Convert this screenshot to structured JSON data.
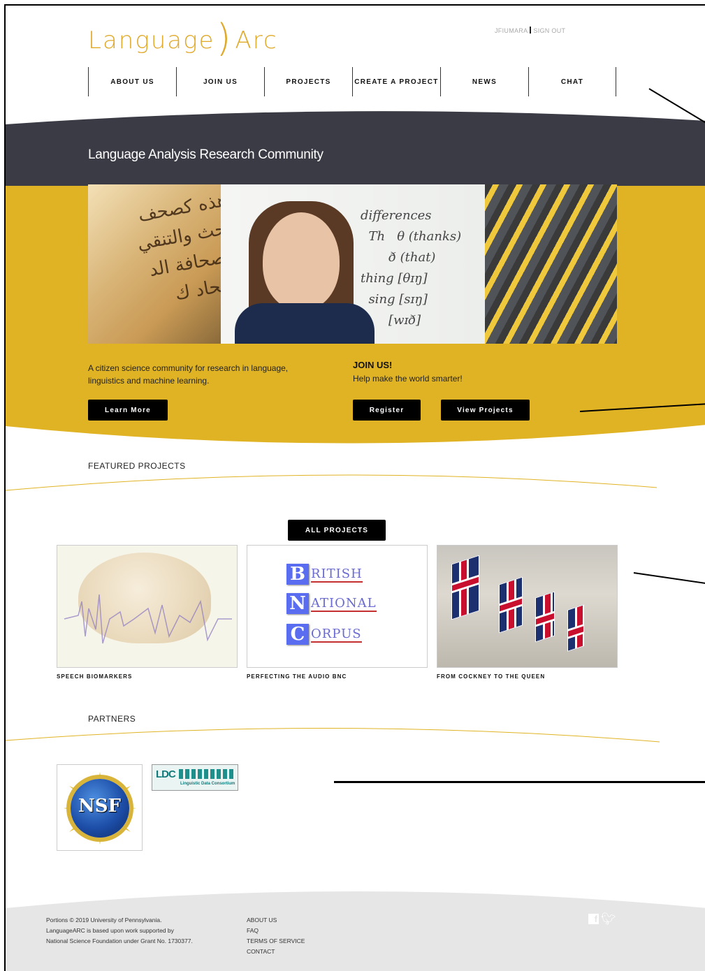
{
  "header": {
    "logo_left": "Language",
    "logo_right": "Arc",
    "user": "JFIUMARA",
    "signout": "SIGN OUT"
  },
  "nav": [
    "ABOUT US",
    "JOIN US",
    "PROJECTS",
    "CREATE A PROJECT",
    "NEWS",
    "CHAT"
  ],
  "hero": {
    "title": "Language Analysis Research Community",
    "description": "A citizen science community for research in language, linguistics and machine learning.",
    "learn_more": "Learn More",
    "join_title": "JOIN US!",
    "join_subtitle": "Help make the world smarter!",
    "register": "Register",
    "view_projects": "View Projects",
    "board_text": "differences\n  Th   θ (thanks)\n       ð (that)\nthing [θɪŋ]\n  sing [sɪŋ]\n       [wɪð]"
  },
  "featured": {
    "label": "FEATURED PROJECTS",
    "all_projects": "ALL PROJECTS",
    "projects": [
      {
        "title": "SPEECH BIOMARKERS"
      },
      {
        "title": "PERFECTING THE AUDIO BNC"
      },
      {
        "title": "FROM COCKNEY TO THE QUEEN"
      }
    ],
    "bnc_rows": [
      {
        "letter": "B",
        "rest": "RITISH"
      },
      {
        "letter": "N",
        "rest": "ATIONAL"
      },
      {
        "letter": "C",
        "rest": "ORPUS"
      }
    ]
  },
  "partners": {
    "label": "PARTNERS",
    "nsf": "NSF",
    "ldc": "LDC",
    "ldc_sub": "Linguistic Data Consortium"
  },
  "footer": {
    "copyright": "Portions © 2019 University of Pennsylvania. LanguageARC is based upon work supported by National Science Foundation under Grant No. 1730377.",
    "links": [
      "ABOUT US",
      "FAQ",
      "TERMS OF SERVICE",
      "CONTACT"
    ]
  },
  "colors": {
    "gold": "#e0b324",
    "dark": "#3a3b45",
    "accent_logo": "#e0a92a"
  },
  "icons": [
    "facebook-icon",
    "twitter-icon"
  ]
}
